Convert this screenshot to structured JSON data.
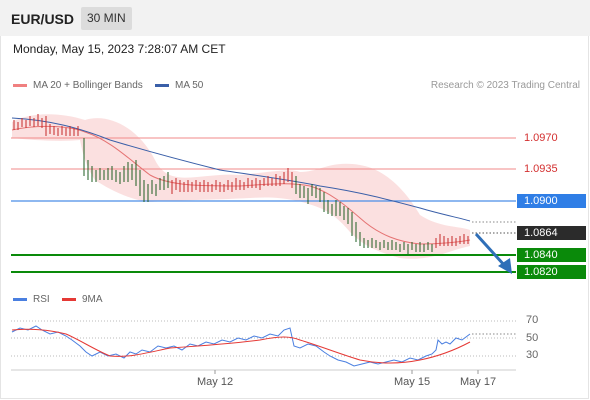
{
  "header": {
    "symbol": "EUR/USD",
    "timeframe": "30 MIN"
  },
  "datetime": "Monday, May 15, 2023 7:28:07 AM CET",
  "legend": {
    "ma20_label": "MA 20 + Bollinger Bands",
    "ma50_label": "MA 50",
    "copyright": "Research © 2023 Trading Central"
  },
  "levels": {
    "r2": "1.0970",
    "r1": "1.0935",
    "pivot": "1.0900",
    "last": "1.0864",
    "s1": "1.0840",
    "s2": "1.0820"
  },
  "rsi": {
    "label": "RSI",
    "ma_label": "9MA",
    "ticks": [
      "70",
      "50",
      "30"
    ]
  },
  "x_axis": {
    "labels": [
      "May 12",
      "May 15",
      "May 17"
    ]
  },
  "colors": {
    "resistance": "#d32f2f",
    "pivot": "#2f7ee6",
    "support": "#0a8a0a",
    "bollinger": "#f8c8c8",
    "ma50": "#3a5fa8",
    "rsi": "#3a6fd8",
    "rsi_ma": "#e53935",
    "bull": "#d32f2f",
    "bear": "#1e5e20"
  },
  "chart_data": {
    "type": "line",
    "title": "EUR/USD 30 MIN",
    "y_levels": [
      1.097,
      1.0935,
      1.09,
      1.0864,
      1.084,
      1.082
    ],
    "price_path": [
      1.0982,
      1.098,
      1.0975,
      1.096,
      1.094,
      1.093,
      1.0925,
      1.0932,
      1.0928,
      1.092,
      1.0922,
      1.0925,
      1.0923,
      1.0928,
      1.093,
      1.0925,
      1.0905,
      1.0885,
      1.087,
      1.0852,
      1.0848,
      1.0846,
      1.0848,
      1.0852,
      1.0858,
      1.0864
    ],
    "ma50_path": [
      1.0985,
      1.097,
      1.0955,
      1.0943,
      1.0935,
      1.0928,
      1.092,
      1.091,
      1.0895,
      1.088,
      1.0864
    ],
    "rsi_values": [
      60,
      62,
      58,
      48,
      42,
      38,
      44,
      48,
      46,
      50,
      52,
      54,
      62,
      44,
      40,
      36,
      30,
      32,
      34,
      48,
      58,
      60
    ],
    "rsi_ma_values": [
      58,
      60,
      58,
      52,
      46,
      42,
      42,
      44,
      46,
      48,
      50,
      52,
      54,
      50,
      46,
      40,
      36,
      34,
      34,
      40,
      48,
      56
    ],
    "rsi_ylim": [
      30,
      70
    ]
  }
}
